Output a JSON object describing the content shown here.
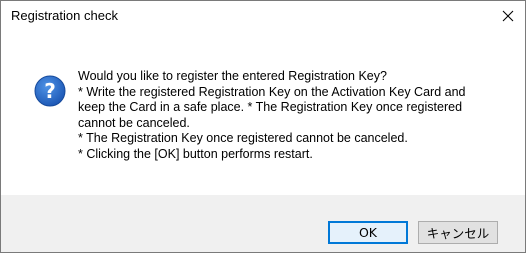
{
  "window": {
    "title": "Registration check"
  },
  "message": {
    "lines": [
      "Would you like to register the entered Registration Key?",
      "* Write the registered Registration Key on the Activation Key Card and",
      "keep the Card in a safe place. * The Registration Key once registered",
      "cannot be canceled.",
      "* The Registration Key once registered cannot be canceled.",
      "* Clicking the [OK] button performs restart."
    ]
  },
  "buttons": {
    "ok": "OK",
    "cancel": "キャンセル"
  },
  "icons": {
    "close": "close-icon",
    "question": "question-icon"
  },
  "colors": {
    "footer_bg": "#f0f0f0",
    "icon_blue": "#1f66c2",
    "focus_border": "#0078d7"
  }
}
